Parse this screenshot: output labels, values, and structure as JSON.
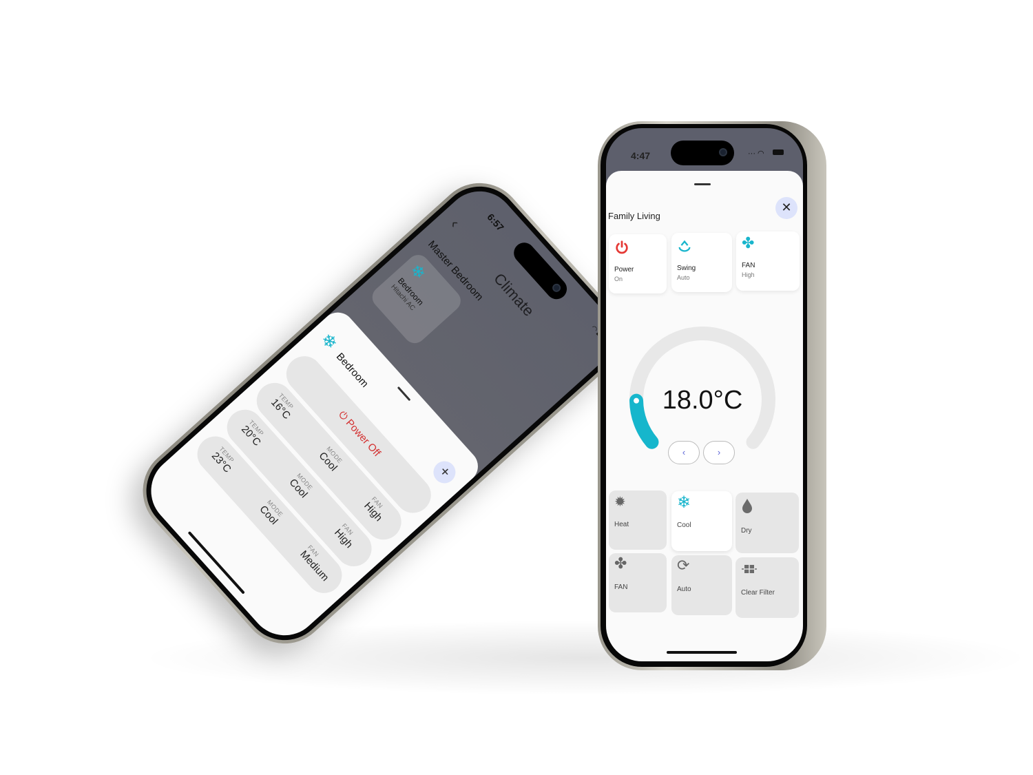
{
  "left_phone": {
    "status_time": "6:57",
    "nav_title": "Climate",
    "back_icon": "chevron-left-icon",
    "section_title": "Master Bedroom",
    "device_card": {
      "name": "Bedroom",
      "model": "Hitachi AC",
      "icon": "snowflake-icon"
    },
    "sheet": {
      "title": "Bedroom",
      "power_label": "Power Off",
      "add_icon": "plus-icon",
      "presets": [
        {
          "temp_label": "TEMP",
          "temp": "16°C",
          "mode_label": "MODE",
          "mode": "Cool",
          "fan_label": "FAN",
          "fan": "High"
        },
        {
          "temp_label": "TEMP",
          "temp": "20°C",
          "mode_label": "MODE",
          "mode": "Cool",
          "fan_label": "FAN",
          "fan": "High"
        },
        {
          "temp_label": "TEMP",
          "temp": "23°C",
          "mode_label": "MODE",
          "mode": "Cool",
          "fan_label": "FAN",
          "fan": "Medium"
        }
      ]
    }
  },
  "right_phone": {
    "status_time": "4:47",
    "title": "Family Living",
    "close_icon": "close-icon",
    "quick": [
      {
        "label": "Power",
        "value": "On",
        "icon": "power-icon",
        "color": "#e53935"
      },
      {
        "label": "Swing",
        "value": "Auto",
        "icon": "swing-icon",
        "color": "#19b5cc"
      },
      {
        "label": "FAN",
        "value": "High",
        "icon": "fan-icon",
        "color": "#19b5cc"
      }
    ],
    "temperature": "18.0°C",
    "dial_level_fraction": 0.15,
    "prev_label": "‹",
    "next_label": "›",
    "modes": [
      {
        "label": "Heat",
        "icon": "sun-icon",
        "selected": false
      },
      {
        "label": "Cool",
        "icon": "snowflake-icon",
        "selected": true
      },
      {
        "label": "Dry",
        "icon": "droplet-icon",
        "selected": false
      },
      {
        "label": "FAN",
        "icon": "fan-icon",
        "selected": false
      },
      {
        "label": "Auto",
        "icon": "sync-icon",
        "selected": false
      },
      {
        "label": "Clear Filter",
        "icon": "filter-icon",
        "selected": false
      }
    ],
    "colors": {
      "accent": "#19b5cc",
      "power": "#e53935",
      "close_bg": "#dde3fb",
      "nav_chevron": "#5a63d6"
    }
  }
}
